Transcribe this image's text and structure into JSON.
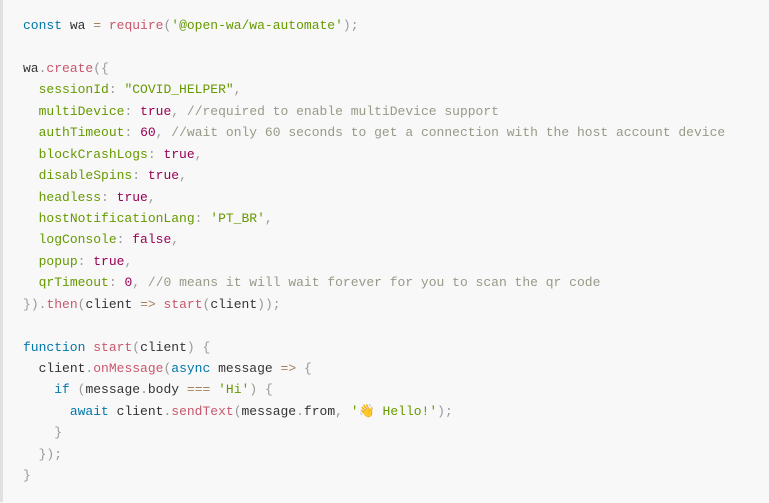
{
  "code": {
    "l1_const": "const",
    "l1_wa": " wa ",
    "l1_eq": "=",
    "l1_req": " require",
    "l1_p1": "(",
    "l1_mod": "'@open-wa/wa-automate'",
    "l1_p2": ")",
    "l1_semi": ";",
    "l3_wa": "wa",
    "l3_dot": ".",
    "l3_create": "create",
    "l3_p1": "(",
    "l3_brace": "{",
    "l4_ind": "  ",
    "l4_key": "sessionId",
    "l4_colon": ":",
    "l4_sp": " ",
    "l4_val": "\"COVID_HELPER\"",
    "l4_comma": ",",
    "l5_ind": "  ",
    "l5_key": "multiDevice",
    "l5_colon": ":",
    "l5_sp": " ",
    "l5_val": "true",
    "l5_comma": ",",
    "l5_csp": " ",
    "l5_comment": "//required to enable multiDevice support",
    "l6_ind": "  ",
    "l6_key": "authTimeout",
    "l6_colon": ":",
    "l6_sp": " ",
    "l6_val": "60",
    "l6_comma": ",",
    "l6_csp": " ",
    "l6_comment": "//wait only 60 seconds to get a connection with the host account device",
    "l7_ind": "  ",
    "l7_key": "blockCrashLogs",
    "l7_colon": ":",
    "l7_sp": " ",
    "l7_val": "true",
    "l7_comma": ",",
    "l8_ind": "  ",
    "l8_key": "disableSpins",
    "l8_colon": ":",
    "l8_sp": " ",
    "l8_val": "true",
    "l8_comma": ",",
    "l9_ind": "  ",
    "l9_key": "headless",
    "l9_colon": ":",
    "l9_sp": " ",
    "l9_val": "true",
    "l9_comma": ",",
    "l10_ind": "  ",
    "l10_key": "hostNotificationLang",
    "l10_colon": ":",
    "l10_sp": " ",
    "l10_val": "'PT_BR'",
    "l10_comma": ",",
    "l11_ind": "  ",
    "l11_key": "logConsole",
    "l11_colon": ":",
    "l11_sp": " ",
    "l11_val": "false",
    "l11_comma": ",",
    "l12_ind": "  ",
    "l12_key": "popup",
    "l12_colon": ":",
    "l12_sp": " ",
    "l12_val": "true",
    "l12_comma": ",",
    "l13_ind": "  ",
    "l13_key": "qrTimeout",
    "l13_colon": ":",
    "l13_sp": " ",
    "l13_val": "0",
    "l13_comma": ",",
    "l13_csp": " ",
    "l13_comment": "//0 means it will wait forever for you to scan the qr code",
    "l14_brace": "}",
    "l14_p1": ")",
    "l14_dot": ".",
    "l14_then": "then",
    "l14_p2": "(",
    "l14_client": "client ",
    "l14_arrow": "=>",
    "l14_sp": " ",
    "l14_start": "start",
    "l14_p3": "(",
    "l14_cl2": "client",
    "l14_p4": ")",
    "l14_p5": ")",
    "l14_semi": ";",
    "l16_fn": "function",
    "l16_sp": " ",
    "l16_start": "start",
    "l16_p1": "(",
    "l16_client": "client",
    "l16_p2": ")",
    "l16_sp2": " ",
    "l16_brace": "{",
    "l17_ind": "  ",
    "l17_cl": "client",
    "l17_dot": ".",
    "l17_on": "onMessage",
    "l17_p1": "(",
    "l17_async": "async",
    "l17_sp": " ",
    "l17_msg": "message ",
    "l17_arrow": "=>",
    "l17_sp2": " ",
    "l17_brace": "{",
    "l18_ind": "    ",
    "l18_if": "if",
    "l18_sp": " ",
    "l18_p1": "(",
    "l18_msg": "message",
    "l18_dot": ".",
    "l18_body": "body ",
    "l18_eq": "===",
    "l18_sp2": " ",
    "l18_hi": "'Hi'",
    "l18_p2": ")",
    "l18_sp3": " ",
    "l18_brace": "{",
    "l19_ind": "      ",
    "l19_await": "await",
    "l19_sp": " ",
    "l19_cl": "client",
    "l19_dot": ".",
    "l19_send": "sendText",
    "l19_p1": "(",
    "l19_msg": "message",
    "l19_dot2": ".",
    "l19_from": "from",
    "l19_comma": ",",
    "l19_sp2": " ",
    "l19_hello": "'👋 Hello!'",
    "l19_p2": ")",
    "l19_semi": ";",
    "l20_ind": "    ",
    "l20_brace": "}",
    "l21_ind": "  ",
    "l21_brace": "}",
    "l21_p1": ")",
    "l21_semi": ";",
    "l22_brace": "}"
  }
}
